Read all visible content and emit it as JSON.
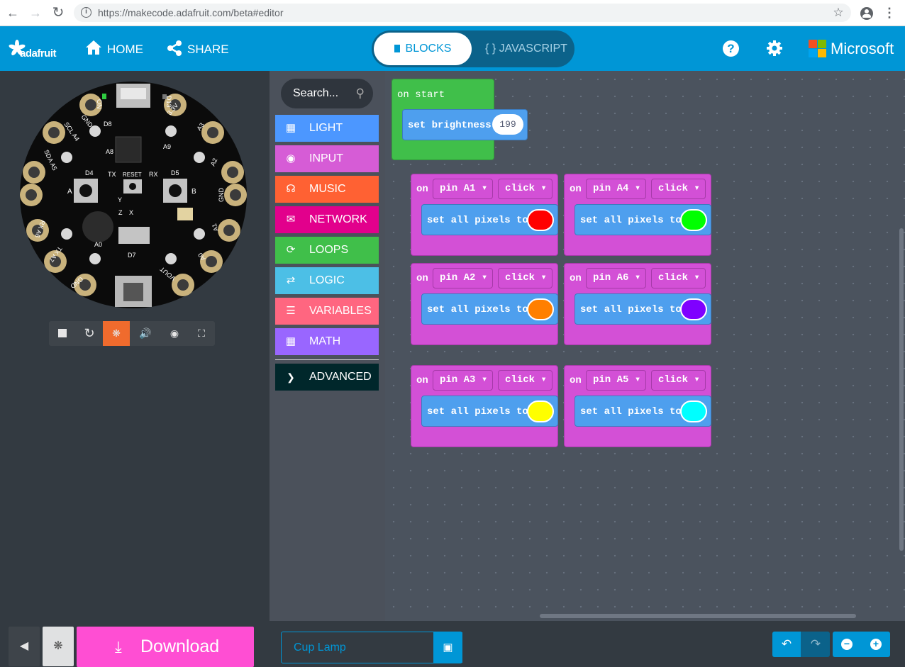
{
  "browser": {
    "url": "https://makecode.adafruit.com/beta#editor"
  },
  "header": {
    "logo": "adafruit",
    "home_label": "HOME",
    "share_label": "SHARE",
    "blocks_label": "BLOCKS",
    "javascript_label": "{ } JAVASCRIPT",
    "brand": "Microsoft",
    "accent": "#0096d6"
  },
  "board": {
    "labels": {
      "gnd_top": "GND",
      "a1_3v3": "3.3V",
      "d8": "D8",
      "d13": "D13",
      "on": "ON",
      "a8": "A8",
      "a9": "A9",
      "d4": "D4",
      "d5": "D5",
      "tx": "TX",
      "rx": "RX",
      "reset": "RESET",
      "scl": "SCL A4",
      "sda": "SDA A5",
      "a3": "A3",
      "a2": "A2",
      "gnd_right": "GND",
      "a1": "A1",
      "a0": "A0",
      "a0_right": "A0",
      "d7": "D7",
      "rx_a6": "RX A6",
      "tx_a7": "TX A7",
      "gnd_bottom": "GND",
      "vout": "VOUT",
      "btn_a": "A",
      "btn_b": "B",
      "y": "Y",
      "z": "Z",
      "x": "X"
    }
  },
  "sim_toolbar": {
    "buttons": [
      "stop-icon",
      "restart-icon",
      "debug-icon",
      "sound-icon",
      "screenshot-icon",
      "fullscreen-icon"
    ]
  },
  "toolbox": {
    "search_placeholder": "Search...",
    "categories": [
      {
        "label": "LIGHT",
        "color": "#4c97ff",
        "icon": "grid"
      },
      {
        "label": "INPUT",
        "color": "#d65cd6",
        "icon": "circle"
      },
      {
        "label": "MUSIC",
        "color": "#ff6133",
        "icon": "headphones"
      },
      {
        "label": "NETWORK",
        "color": "#e2008c",
        "icon": "chat"
      },
      {
        "label": "LOOPS",
        "color": "#40bf4a",
        "icon": "loop"
      },
      {
        "label": "LOGIC",
        "color": "#4cbfe6",
        "icon": "shuffle"
      },
      {
        "label": "VARIABLES",
        "color": "#ff6680",
        "icon": "list"
      },
      {
        "label": "MATH",
        "color": "#9966ff",
        "icon": "calculator"
      }
    ],
    "advanced_label": "ADVANCED"
  },
  "workspace": {
    "on_start": {
      "label": "on start",
      "set_brightness_label": "set brightness",
      "brightness_value": "199"
    },
    "events": [
      {
        "on": "on",
        "pin": "pin A1",
        "action": "click",
        "statement": "set all pixels to",
        "color": "#ff0000"
      },
      {
        "on": "on",
        "pin": "pin A4",
        "action": "click",
        "statement": "set all pixels to",
        "color": "#00ff00"
      },
      {
        "on": "on",
        "pin": "pin A2",
        "action": "click",
        "statement": "set all pixels to",
        "color": "#ff7f00"
      },
      {
        "on": "on",
        "pin": "pin A6",
        "action": "click",
        "statement": "set all pixels to",
        "color": "#7f00ff"
      },
      {
        "on": "on",
        "pin": "pin A3",
        "action": "click",
        "statement": "set all pixels to",
        "color": "#ffff00"
      },
      {
        "on": "on",
        "pin": "pin A5",
        "action": "click",
        "statement": "set all pixels to",
        "color": "#00ffff"
      }
    ]
  },
  "footer": {
    "download_label": "Download",
    "project_name": "Cup Lamp",
    "download_color": "#ff4ed3"
  }
}
